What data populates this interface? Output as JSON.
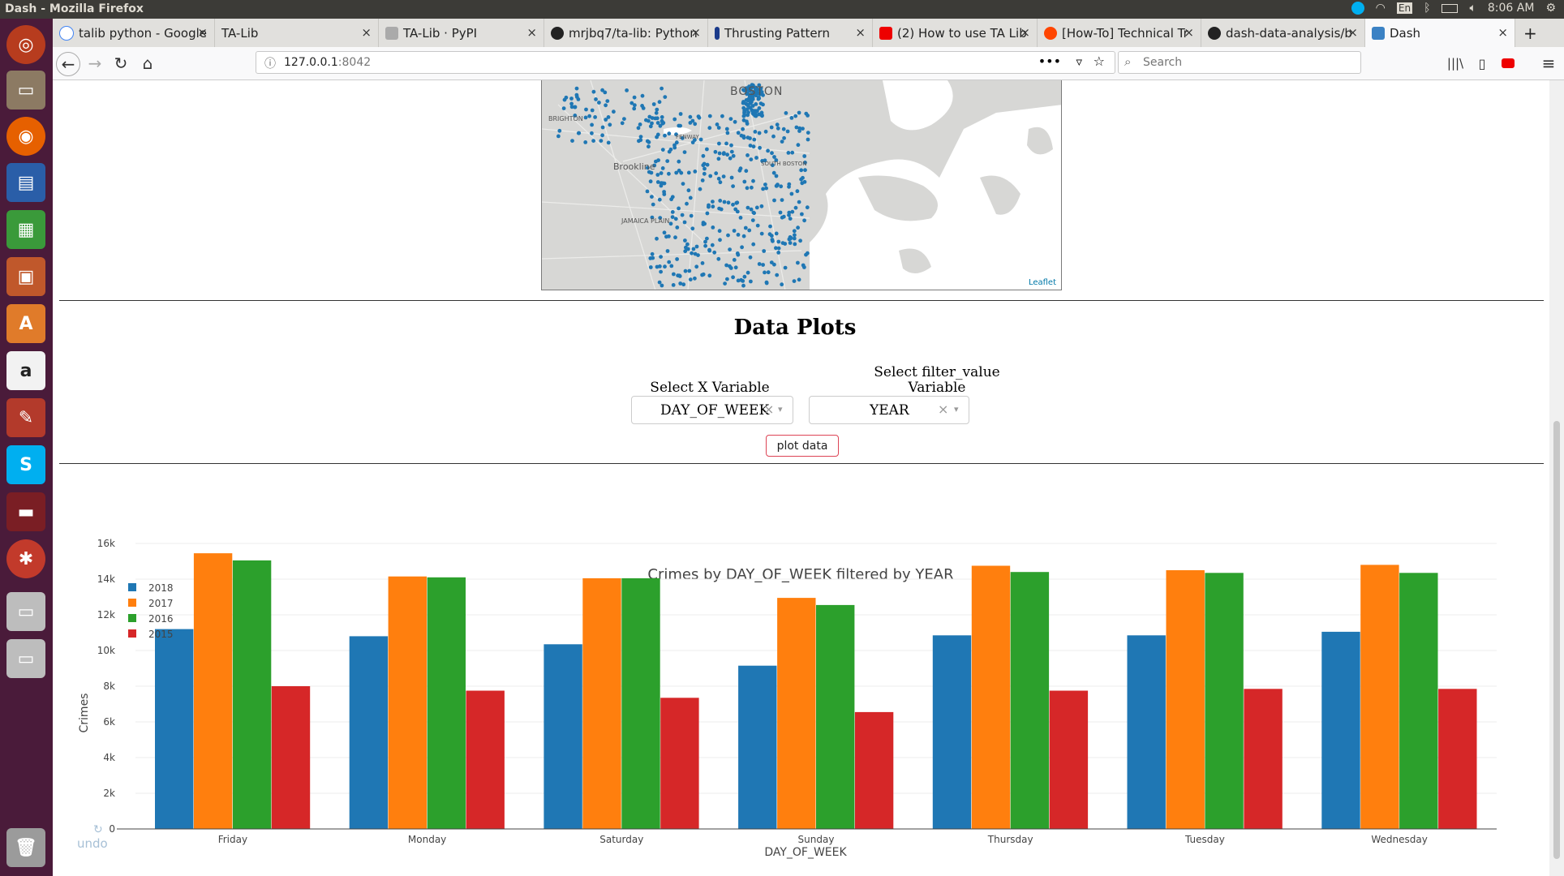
{
  "os": {
    "window_title": "Dash - Mozilla Firefox",
    "clock": "8:06 AM",
    "lang": "En"
  },
  "tabs": [
    {
      "label": "talib python - Google"
    },
    {
      "label": "TA-Lib"
    },
    {
      "label": "TA-Lib · PyPI"
    },
    {
      "label": "mrjbq7/ta-lib: Python"
    },
    {
      "label": "Thrusting Pattern"
    },
    {
      "label": "(2) How to use TA Lib"
    },
    {
      "label": "[How-To] Technical Tr"
    },
    {
      "label": "dash-data-analysis/b"
    },
    {
      "label": "Dash"
    }
  ],
  "nav": {
    "url_host": "127.0.0.1",
    "url_port": ":8042",
    "search_placeholder": "Search"
  },
  "map": {
    "attribution": "Leaflet",
    "labels": [
      "BOSTON",
      "BRIGHTON",
      "Brookline",
      "JAMAICA PLAIN",
      "FENWAY",
      "SOUTH BOSTON"
    ]
  },
  "section": {
    "title": "Data Plots",
    "x_label_text": "Select X Variable",
    "x_value": "DAY_OF_WEEK",
    "filter_label_line1": "Select filter_value",
    "filter_label_line2": "Variable",
    "filter_value": "YEAR",
    "plot_button": "plot data",
    "clear_glyph": "×",
    "arrow_glyph": "▾",
    "undo": "undo"
  },
  "colors": {
    "2018": "#1f77b4",
    "2017": "#ff7f0e",
    "2016": "#2ca02c",
    "2015": "#d62728"
  },
  "chart_data": {
    "type": "bar",
    "title": "Crimes by DAY_OF_WEEK filtered by YEAR",
    "xlabel": "DAY_OF_WEEK",
    "ylabel": "Crimes",
    "ylim": [
      0,
      16000
    ],
    "yticks": [
      0,
      2000,
      4000,
      6000,
      8000,
      10000,
      12000,
      14000,
      16000
    ],
    "ytick_labels": [
      "0",
      "2k",
      "4k",
      "6k",
      "8k",
      "10k",
      "12k",
      "14k",
      "16k"
    ],
    "grid": true,
    "legend_position": "top-left",
    "categories": [
      "Friday",
      "Monday",
      "Saturday",
      "Sunday",
      "Thursday",
      "Tuesday",
      "Wednesday"
    ],
    "series": [
      {
        "name": "2018",
        "values": [
          11200,
          10800,
          10350,
          9150,
          10850,
          10850,
          11050
        ]
      },
      {
        "name": "2017",
        "values": [
          15450,
          14150,
          14050,
          12950,
          14750,
          14500,
          14800
        ]
      },
      {
        "name": "2016",
        "values": [
          15050,
          14100,
          14050,
          12550,
          14400,
          14350,
          14350
        ]
      },
      {
        "name": "2015",
        "values": [
          8000,
          7750,
          7350,
          6550,
          7750,
          7850,
          7850
        ]
      }
    ]
  }
}
